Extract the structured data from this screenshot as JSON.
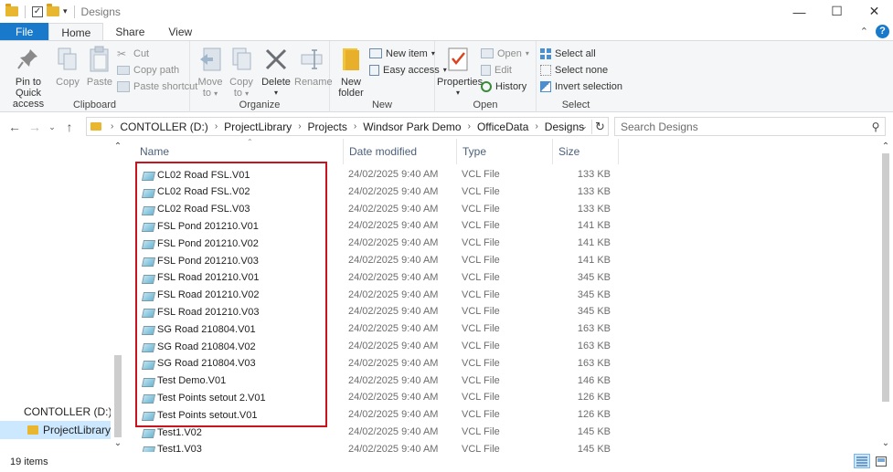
{
  "window": {
    "title": "Designs",
    "minimize": "—",
    "maximize": "☐",
    "close": "✕"
  },
  "tabs": [
    "File",
    "Home",
    "Share",
    "View"
  ],
  "ribbon": {
    "clipboard": {
      "label": "Clipboard",
      "pin": [
        "Pin to Quick",
        "access"
      ],
      "copy": "Copy",
      "paste": "Paste",
      "cut": "Cut",
      "copy_path": "Copy path",
      "paste_shortcut": "Paste shortcut"
    },
    "organize": {
      "label": "Organize",
      "move_to": [
        "Move",
        "to"
      ],
      "copy_to": [
        "Copy",
        "to"
      ],
      "delete": "Delete",
      "rename": "Rename"
    },
    "new": {
      "label": "New",
      "new_folder": [
        "New",
        "folder"
      ],
      "new_item": "New item",
      "easy_access": "Easy access"
    },
    "open": {
      "label": "Open",
      "properties": "Properties",
      "open": "Open",
      "edit": "Edit",
      "history": "History"
    },
    "select": {
      "label": "Select",
      "select_all": "Select all",
      "select_none": "Select none",
      "invert": "Invert selection"
    }
  },
  "address": {
    "crumbs": [
      "CONTOLLER (D:)",
      "ProjectLibrary",
      "Projects",
      "Windsor Park Demo",
      "OfficeData",
      "Designs"
    ]
  },
  "search": {
    "placeholder": "Search Designs"
  },
  "navpane": {
    "items": [
      {
        "label": "CONTOLLER (D:)"
      },
      {
        "label": "ProjectLibrary"
      }
    ]
  },
  "columns": {
    "name": "Name",
    "date": "Date modified",
    "type": "Type",
    "size": "Size"
  },
  "files": [
    {
      "name": "CL02 Road FSL.V01",
      "date": "24/02/2025 9:40 AM",
      "type": "VCL File",
      "size": "133 KB"
    },
    {
      "name": "CL02 Road FSL.V02",
      "date": "24/02/2025 9:40 AM",
      "type": "VCL File",
      "size": "133 KB"
    },
    {
      "name": "CL02 Road FSL.V03",
      "date": "24/02/2025 9:40 AM",
      "type": "VCL File",
      "size": "133 KB"
    },
    {
      "name": "FSL Pond 201210.V01",
      "date": "24/02/2025 9:40 AM",
      "type": "VCL File",
      "size": "141 KB"
    },
    {
      "name": "FSL Pond 201210.V02",
      "date": "24/02/2025 9:40 AM",
      "type": "VCL File",
      "size": "141 KB"
    },
    {
      "name": "FSL Pond 201210.V03",
      "date": "24/02/2025 9:40 AM",
      "type": "VCL File",
      "size": "141 KB"
    },
    {
      "name": "FSL Road 201210.V01",
      "date": "24/02/2025 9:40 AM",
      "type": "VCL File",
      "size": "345 KB"
    },
    {
      "name": "FSL Road 201210.V02",
      "date": "24/02/2025 9:40 AM",
      "type": "VCL File",
      "size": "345 KB"
    },
    {
      "name": "FSL Road 201210.V03",
      "date": "24/02/2025 9:40 AM",
      "type": "VCL File",
      "size": "345 KB"
    },
    {
      "name": "SG Road 210804.V01",
      "date": "24/02/2025 9:40 AM",
      "type": "VCL File",
      "size": "163 KB"
    },
    {
      "name": "SG Road 210804.V02",
      "date": "24/02/2025 9:40 AM",
      "type": "VCL File",
      "size": "163 KB"
    },
    {
      "name": "SG Road 210804.V03",
      "date": "24/02/2025 9:40 AM",
      "type": "VCL File",
      "size": "163 KB"
    },
    {
      "name": "Test Demo.V01",
      "date": "24/02/2025 9:40 AM",
      "type": "VCL File",
      "size": "146 KB"
    },
    {
      "name": "Test Points setout 2.V01",
      "date": "24/02/2025 9:40 AM",
      "type": "VCL File",
      "size": "126 KB"
    },
    {
      "name": "Test Points setout.V01",
      "date": "24/02/2025 9:40 AM",
      "type": "VCL File",
      "size": "126 KB"
    },
    {
      "name": "Test1.V02",
      "date": "24/02/2025 9:40 AM",
      "type": "VCL File",
      "size": "145 KB"
    },
    {
      "name": "Test1.V03",
      "date": "24/02/2025 9:40 AM",
      "type": "VCL File",
      "size": "145 KB"
    }
  ],
  "status": {
    "count": "19 items"
  },
  "colors": {
    "accent": "#1979ca",
    "highlight": "#c8141e",
    "selected": "#cce8ff"
  }
}
